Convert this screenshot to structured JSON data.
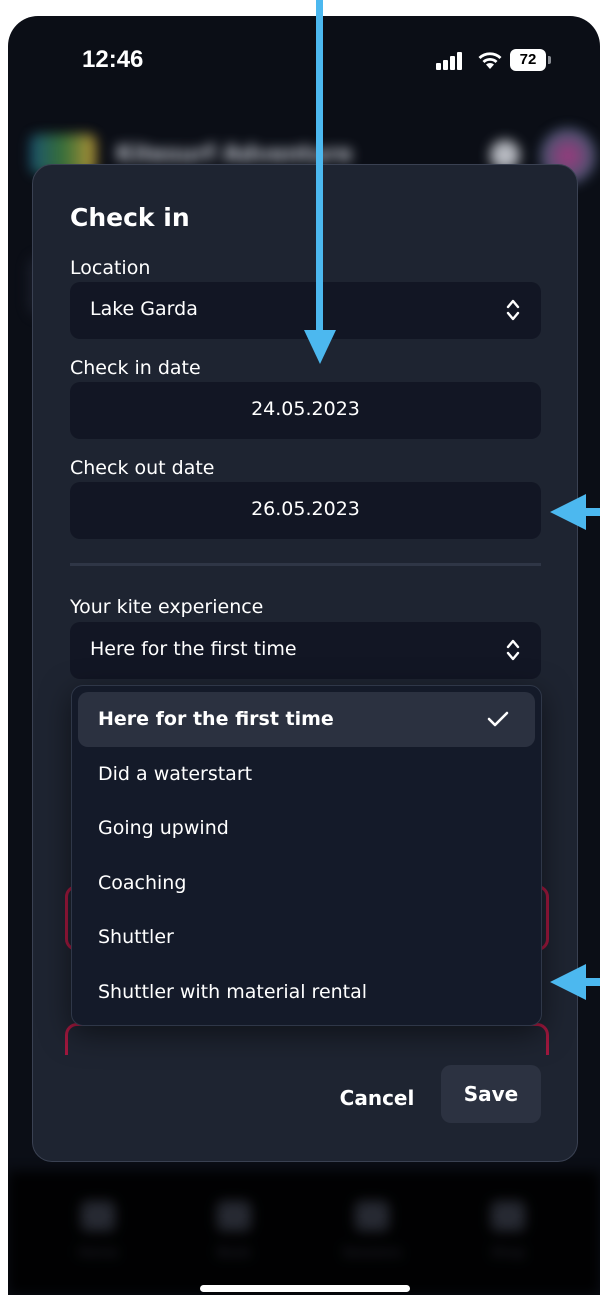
{
  "status_bar": {
    "time": "12:46",
    "battery": "72"
  },
  "background": {
    "app_title": "Kitesurf Adventure",
    "tabs": [
      "Home",
      "Book",
      "Sessions",
      "Shop"
    ]
  },
  "modal": {
    "title": "Check in",
    "location": {
      "label": "Location",
      "value": "Lake Garda"
    },
    "check_in": {
      "label": "Check in date",
      "value": "24.05.2023"
    },
    "check_out": {
      "label": "Check out date",
      "value": "26.05.2023"
    },
    "experience": {
      "label": "Your kite experience",
      "value": "Here for the first time"
    },
    "options": [
      "Here for the first time",
      "Did a waterstart",
      "Going upwind",
      "Coaching",
      "Shuttler",
      "Shuttler with material rental"
    ],
    "selected_option_index": 0,
    "cancel_label": "Cancel",
    "save_label": "Save"
  },
  "colors": {
    "modal_bg": "#1e2431",
    "field_bg": "#121624",
    "arrow": "#4cb8ef",
    "accent_red": "#a0183e"
  }
}
